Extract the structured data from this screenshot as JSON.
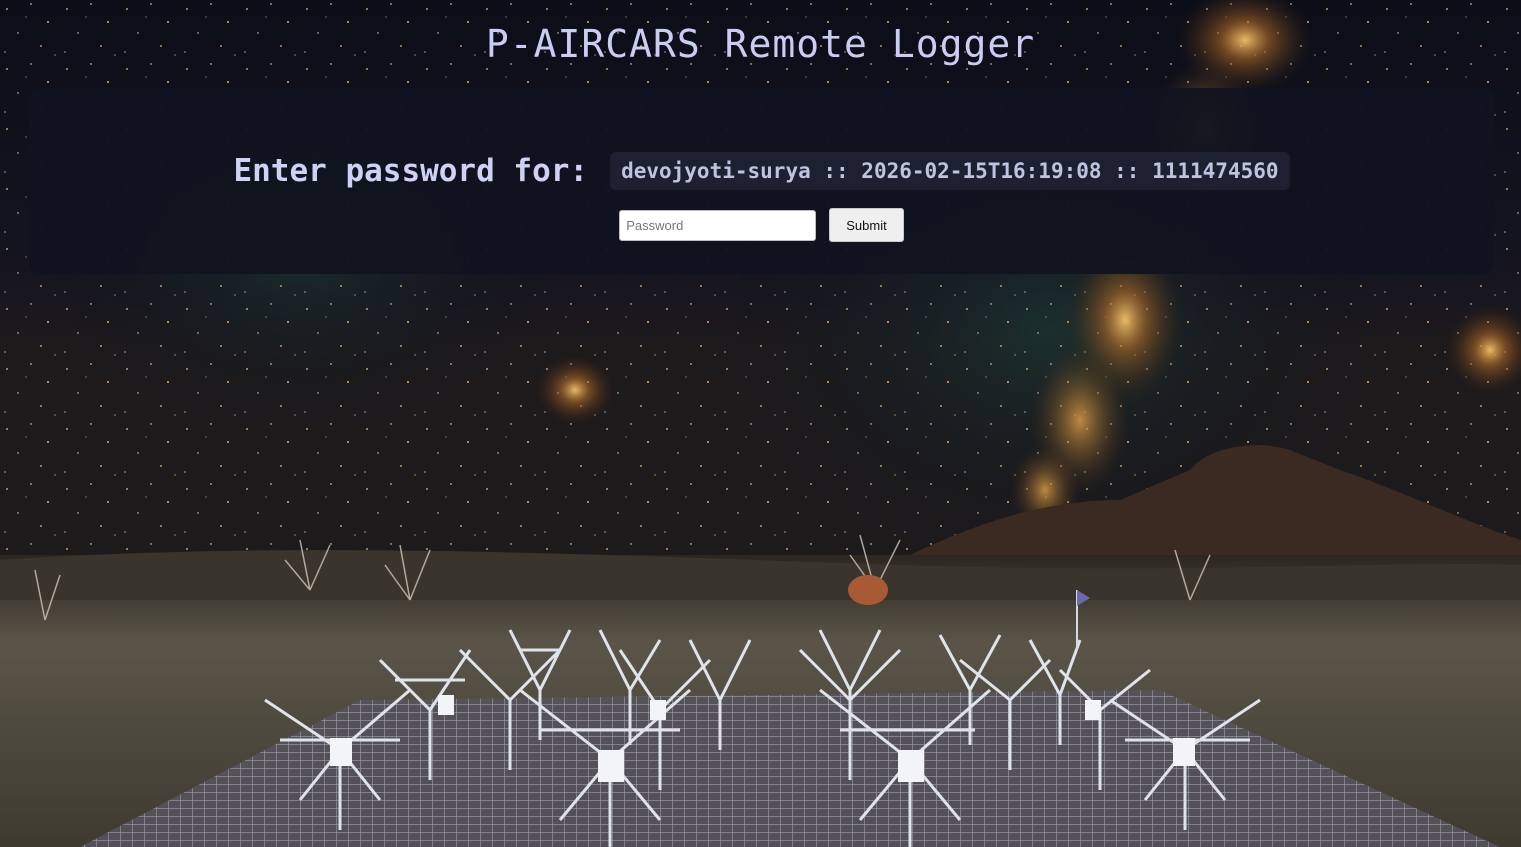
{
  "page": {
    "title": "P-AIRCARS Remote Logger"
  },
  "login": {
    "prompt_label": "Enter password for:",
    "session_id": "devojyoti-surya :: 2026-02-15T16:19:08 :: 1111474560",
    "password_placeholder": "Password",
    "password_value": "",
    "submit_label": "Submit"
  },
  "background": {
    "description_icon": "night-sky-radio-telescope-photo",
    "sky_color": "#080a14",
    "milkyway_color": "#c98a3a",
    "ground_color": "#4a4538",
    "antenna_color": "#d8dde6"
  }
}
